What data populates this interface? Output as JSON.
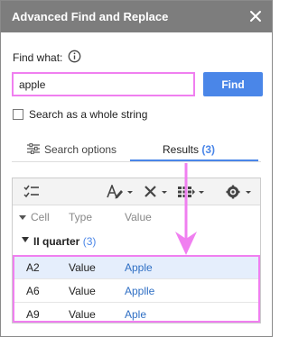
{
  "dialog": {
    "title": "Advanced Find and Replace",
    "close_icon": "close-icon"
  },
  "find": {
    "label": "Find what:",
    "value": "apple",
    "button_label": "Find",
    "info_icon": "info-icon"
  },
  "options": {
    "whole_string_label": "Search as a whole string",
    "whole_string_checked": false
  },
  "tabs": {
    "search_options_label": "Search options",
    "results_label": "Results",
    "results_count": "(3)",
    "active": "results"
  },
  "toolbar": {
    "icons": [
      "checklist-icon",
      "text-format-icon",
      "delete-icon",
      "columns-icon",
      "settings-icon"
    ]
  },
  "results": {
    "columns": {
      "cell": "Cell",
      "type": "Value",
      "value": "Value"
    },
    "column_headers": [
      "Cell",
      "Type",
      "Value"
    ],
    "group": {
      "label": "II quarter",
      "count": "(3)"
    },
    "rows": [
      {
        "cell": "A2",
        "type": "Value",
        "value": "Apple",
        "selected": true
      },
      {
        "cell": "A6",
        "type": "Value",
        "value": "Applle",
        "selected": false
      },
      {
        "cell": "A9",
        "type": "Value",
        "value": "Aple",
        "selected": false
      }
    ]
  },
  "colors": {
    "titlebar": "#7d7d7d",
    "accent": "#4a86e8",
    "highlight": "#f07ff0",
    "selected_row": "#e5eefc",
    "value_link": "#2f6fc4"
  }
}
